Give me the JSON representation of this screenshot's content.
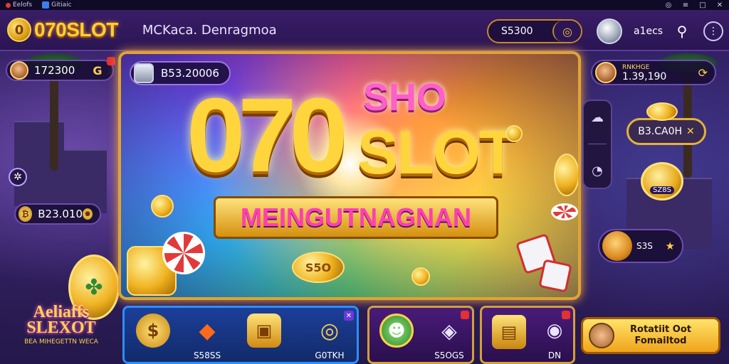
{
  "window": {
    "tab_left": "Eelofs",
    "tab_second": "Gitiaic",
    "window_controls": [
      "◎",
      "≡",
      "□",
      "✕"
    ]
  },
  "header": {
    "logo_text": "070SLOT",
    "subtitle": "MCKaca. Denragmoa",
    "balance_value": "S5300",
    "username": "a1ecs"
  },
  "left": {
    "player_value": "172300",
    "pill2_value": "B23.010",
    "game_logo_line1": "Aeliaffs",
    "game_logo_line2": "SLEXOT",
    "game_logo_small": "BEA MIHEGETTN WECA"
  },
  "banner": {
    "balance_value": "B53.20006",
    "headline_number": "070",
    "headline_small": "SHO",
    "headline_word": "SLOT",
    "ribbon_text": "MEINGUTNAGNAN",
    "coin_center_text": "S5O"
  },
  "right": {
    "player_label": "RNKHGE",
    "player_value": "1.39,190",
    "promo_value": "B3.CA0H",
    "promo_icon": "✕",
    "avatar_badge": "SZ8S",
    "pet_value": "S3S"
  },
  "bottom_cards": [
    {
      "label_a": "S58SS",
      "label_b": "G0TKH"
    },
    {
      "label_a": "S5OGS"
    },
    {
      "label_a": "DN"
    }
  ],
  "cta": {
    "line1": "Rotatiit Oot",
    "line2": "Fomailtod"
  },
  "colors": {
    "gold": "#ffd53d",
    "purple_bg": "#2a1553",
    "banner_border": "#e0a432",
    "blue_card": "#2a8fff"
  }
}
